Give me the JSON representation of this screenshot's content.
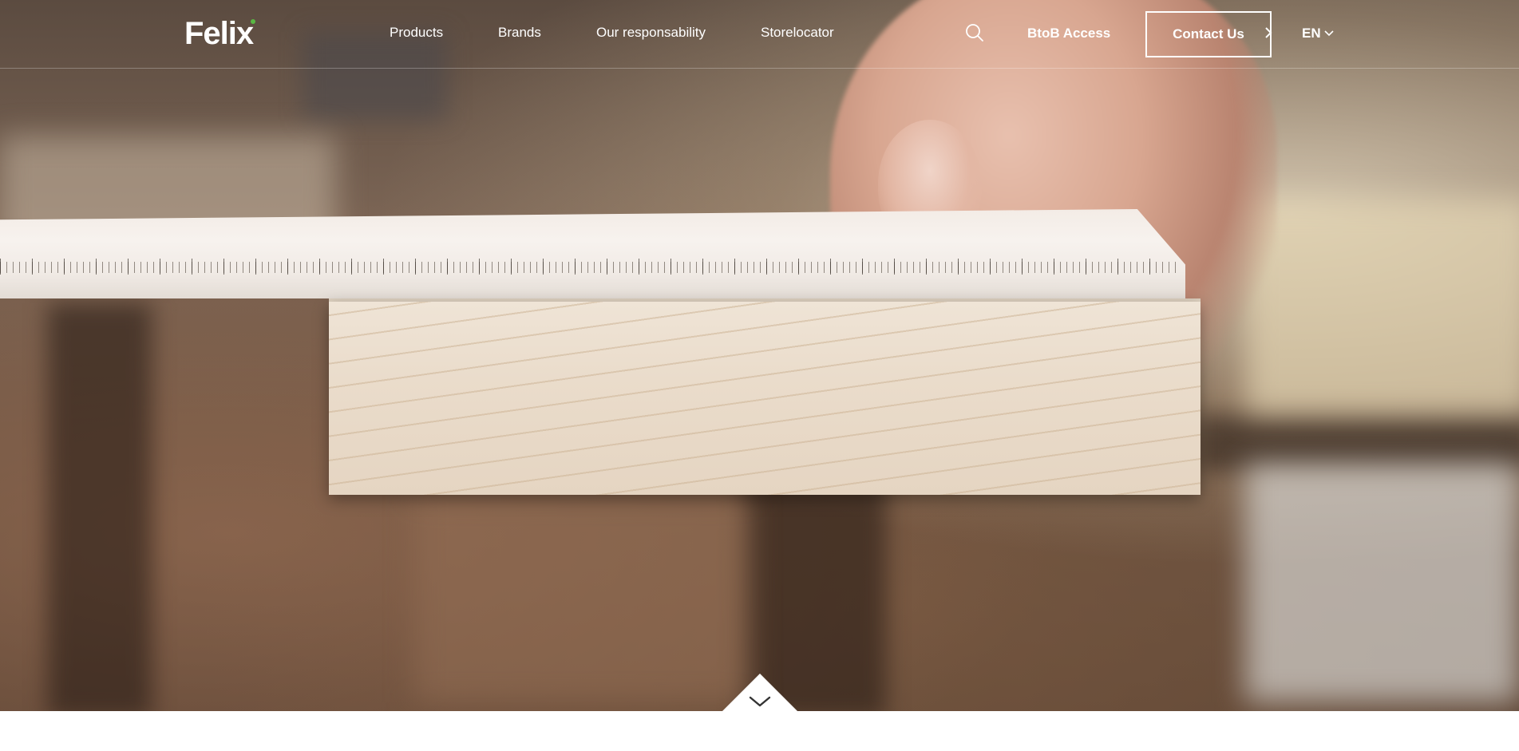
{
  "header": {
    "logo_text": "Felix",
    "nav": [
      {
        "label": "Products"
      },
      {
        "label": "Brands"
      },
      {
        "label": "Our responsability"
      },
      {
        "label": "Storelocator"
      }
    ],
    "search_icon": "search-icon",
    "btob_label": "BtoB Access",
    "contact_label": "Contact Us",
    "contact_icon": "chevron-right-icon",
    "language": "EN",
    "language_icon": "chevron-down-icon"
  },
  "hero": {
    "image": "hand measuring wooden board with ruler",
    "scroll_icon": "chevron-down-icon"
  },
  "colors": {
    "accent": "#59b843",
    "text_on_hero": "#ffffff",
    "page_background": "#ffffff"
  }
}
